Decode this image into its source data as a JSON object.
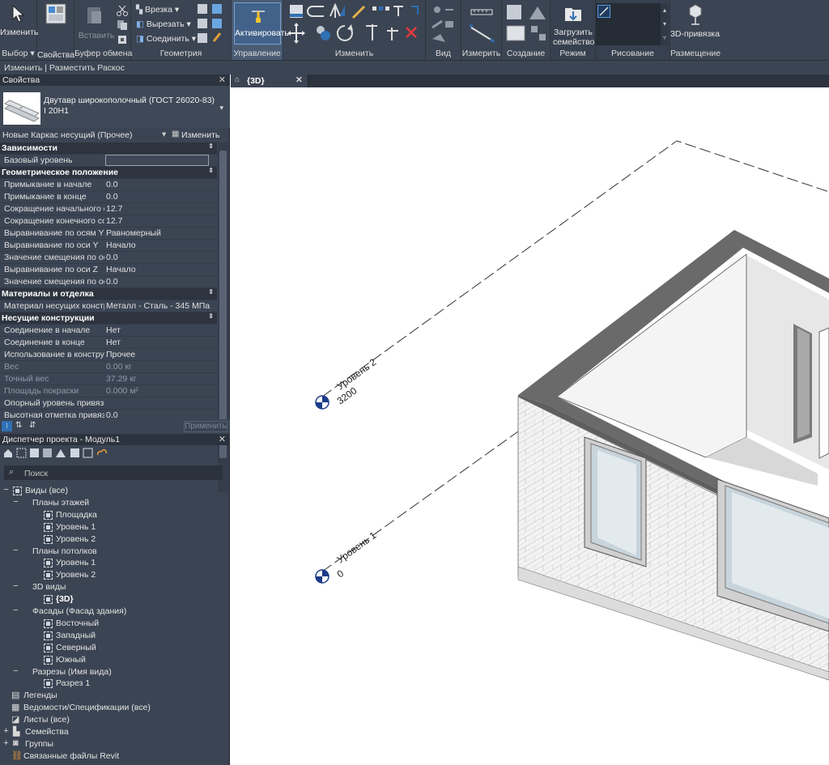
{
  "ribbon": {
    "select_group": {
      "modify": "Изменить",
      "label": "Выбор"
    },
    "properties_group": {
      "properties": "Свойства"
    },
    "clipboard_group": {
      "paste": "Вставить",
      "label": "Буфер обмена"
    },
    "geometry_group": {
      "cope": "Врезка",
      "cut": "Вырезать",
      "join": "Соединить",
      "label": "Геометрия"
    },
    "control_group": {
      "activate": "Активировать",
      "label": "Управление"
    },
    "modify_group": {
      "label": "Изменить"
    },
    "view_group": {
      "label": "Вид"
    },
    "measure_group": {
      "label": "Измерить"
    },
    "create_group": {
      "label": "Создание"
    },
    "mode_group": {
      "load_family": "Загрузить семейство",
      "label": "Режим"
    },
    "draw_group": {
      "label": "Рисование"
    },
    "placement_group": {
      "snap3d": "3D-привязка",
      "label": "Размещение"
    }
  },
  "context_bar": {
    "text": "Изменить | Разместить Раскос"
  },
  "properties": {
    "title": "Свойства",
    "type_name": "Двутавр широкополочный (ГОСТ 26020-83)",
    "type_size": "I 20Н1",
    "instance_filter": "Новые Каркас несущий (Прочее)",
    "edit_type": "Изменить тип",
    "apply": "Применить",
    "rows": [
      {
        "kind": "cat",
        "label": "Зависимости"
      },
      {
        "kind": "row",
        "label": "Базовый уровень",
        "value": "",
        "input": true
      },
      {
        "kind": "cat",
        "label": "Геометрическое положение"
      },
      {
        "kind": "row",
        "label": "Примыкание в начале",
        "value": "0.0"
      },
      {
        "kind": "row",
        "label": "Примыкание в конце",
        "value": "0.0"
      },
      {
        "kind": "row",
        "label": "Сокращение начального сое...",
        "value": "12.7"
      },
      {
        "kind": "row",
        "label": "Сокращение конечного соед...",
        "value": "12.7"
      },
      {
        "kind": "row",
        "label": "Выравнивание по осям YZ",
        "value": "Равномерный"
      },
      {
        "kind": "row",
        "label": "Выравнивание по оси Y",
        "value": "Начало"
      },
      {
        "kind": "row",
        "label": "Значение смещения по оси Y",
        "value": "0.0"
      },
      {
        "kind": "row",
        "label": "Выравнивание по оси Z",
        "value": "Начало"
      },
      {
        "kind": "row",
        "label": "Значение смещения по оси Z",
        "value": "0.0"
      },
      {
        "kind": "cat",
        "label": "Материалы и отделка"
      },
      {
        "kind": "row",
        "label": "Материал несущих конструк...",
        "value": "Металл - Сталь - 345 МПа"
      },
      {
        "kind": "cat",
        "label": "Несущие конструкции"
      },
      {
        "kind": "row",
        "label": "Соединение в начале",
        "value": "Нет"
      },
      {
        "kind": "row",
        "label": "Соединение в конце",
        "value": "Нет"
      },
      {
        "kind": "row",
        "label": "Использование в конструкции",
        "value": "Прочее"
      },
      {
        "kind": "row",
        "label": "Вес",
        "value": "0.00 кг",
        "dim": true
      },
      {
        "kind": "row",
        "label": "Точный вес",
        "value": "37.29 кг",
        "dim": true
      },
      {
        "kind": "row",
        "label": "Площадь покраски",
        "value": "0.000 м²",
        "dim": true
      },
      {
        "kind": "row",
        "label": "Опорный уровень привязки ...",
        "value": ""
      },
      {
        "kind": "row",
        "label": "Высотная отметка привязки ...",
        "value": "0.0"
      }
    ]
  },
  "browser": {
    "title": "Диспетчер проекта - Модуль1",
    "search_placeholder": "Поиск",
    "nodes": [
      {
        "d": 0,
        "t": "−",
        "icon": "view",
        "label": "Виды (все)"
      },
      {
        "d": 1,
        "t": "−",
        "label": "Планы этажей"
      },
      {
        "d": 2,
        "icon": "view",
        "label": "Площадка"
      },
      {
        "d": 2,
        "icon": "view",
        "label": "Уровень 1"
      },
      {
        "d": 2,
        "icon": "view",
        "label": "Уровень 2"
      },
      {
        "d": 1,
        "t": "−",
        "label": "Планы потолков"
      },
      {
        "d": 2,
        "icon": "view",
        "label": "Уровень 1"
      },
      {
        "d": 2,
        "icon": "view",
        "label": "Уровень 2"
      },
      {
        "d": 1,
        "t": "−",
        "label": "3D виды"
      },
      {
        "d": 2,
        "icon": "view",
        "label": "{3D}",
        "bold": true
      },
      {
        "d": 1,
        "t": "−",
        "label": "Фасады (Фасад здания)"
      },
      {
        "d": 2,
        "icon": "view",
        "label": "Восточный"
      },
      {
        "d": 2,
        "icon": "view",
        "label": "Западный"
      },
      {
        "d": 2,
        "icon": "view",
        "label": "Северный"
      },
      {
        "d": 2,
        "icon": "view",
        "label": "Южный"
      },
      {
        "d": 1,
        "t": "−",
        "label": "Разрезы (Имя вида)"
      },
      {
        "d": 2,
        "icon": "view",
        "label": "Разрез 1"
      },
      {
        "d": 0,
        "icon": "legend",
        "label": "Легенды"
      },
      {
        "d": 0,
        "icon": "schedule",
        "label": "Ведомости/Спецификации (все)"
      },
      {
        "d": 0,
        "icon": "sheet",
        "label": "Листы (все)"
      },
      {
        "d": 0,
        "t": "+",
        "icon": "family",
        "label": "Семейства"
      },
      {
        "d": 0,
        "t": "+",
        "icon": "group",
        "label": "Группы"
      },
      {
        "d": 0,
        "icon": "link",
        "label": "Связанные файлы Revit"
      }
    ]
  },
  "view": {
    "tab_label": "{3D}",
    "levels": [
      {
        "name": "Уровень 2",
        "elevation": "3200"
      },
      {
        "name": "Уровень 1",
        "elevation": "0"
      }
    ]
  },
  "colors": {
    "ribbon_bg": "#3b4453",
    "panel_bg": "#3b4453",
    "header_bg": "#2c333e",
    "accent": "#2f6fb3"
  }
}
